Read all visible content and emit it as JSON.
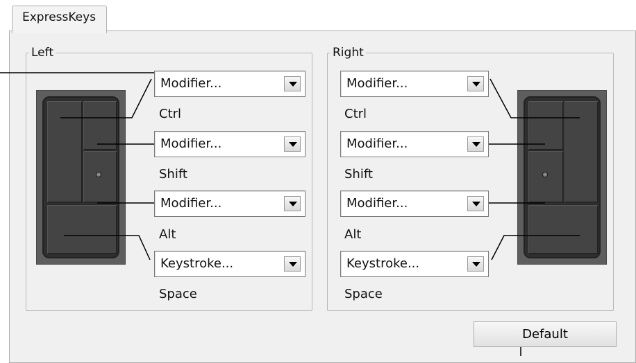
{
  "tabs": [
    {
      "label": "ExpressKeys"
    }
  ],
  "left": {
    "legend": "Left",
    "keys": [
      {
        "dropdown": "Modifier...",
        "assignment": "Ctrl"
      },
      {
        "dropdown": "Modifier...",
        "assignment": "Shift"
      },
      {
        "dropdown": "Modifier...",
        "assignment": "Alt"
      },
      {
        "dropdown": "Keystroke...",
        "assignment": "Space"
      }
    ]
  },
  "right": {
    "legend": "Right",
    "keys": [
      {
        "dropdown": "Modifier...",
        "assignment": "Ctrl"
      },
      {
        "dropdown": "Modifier...",
        "assignment": "Shift"
      },
      {
        "dropdown": "Modifier...",
        "assignment": "Alt"
      },
      {
        "dropdown": "Keystroke...",
        "assignment": "Space"
      }
    ]
  },
  "buttons": {
    "default_label": "Default"
  }
}
